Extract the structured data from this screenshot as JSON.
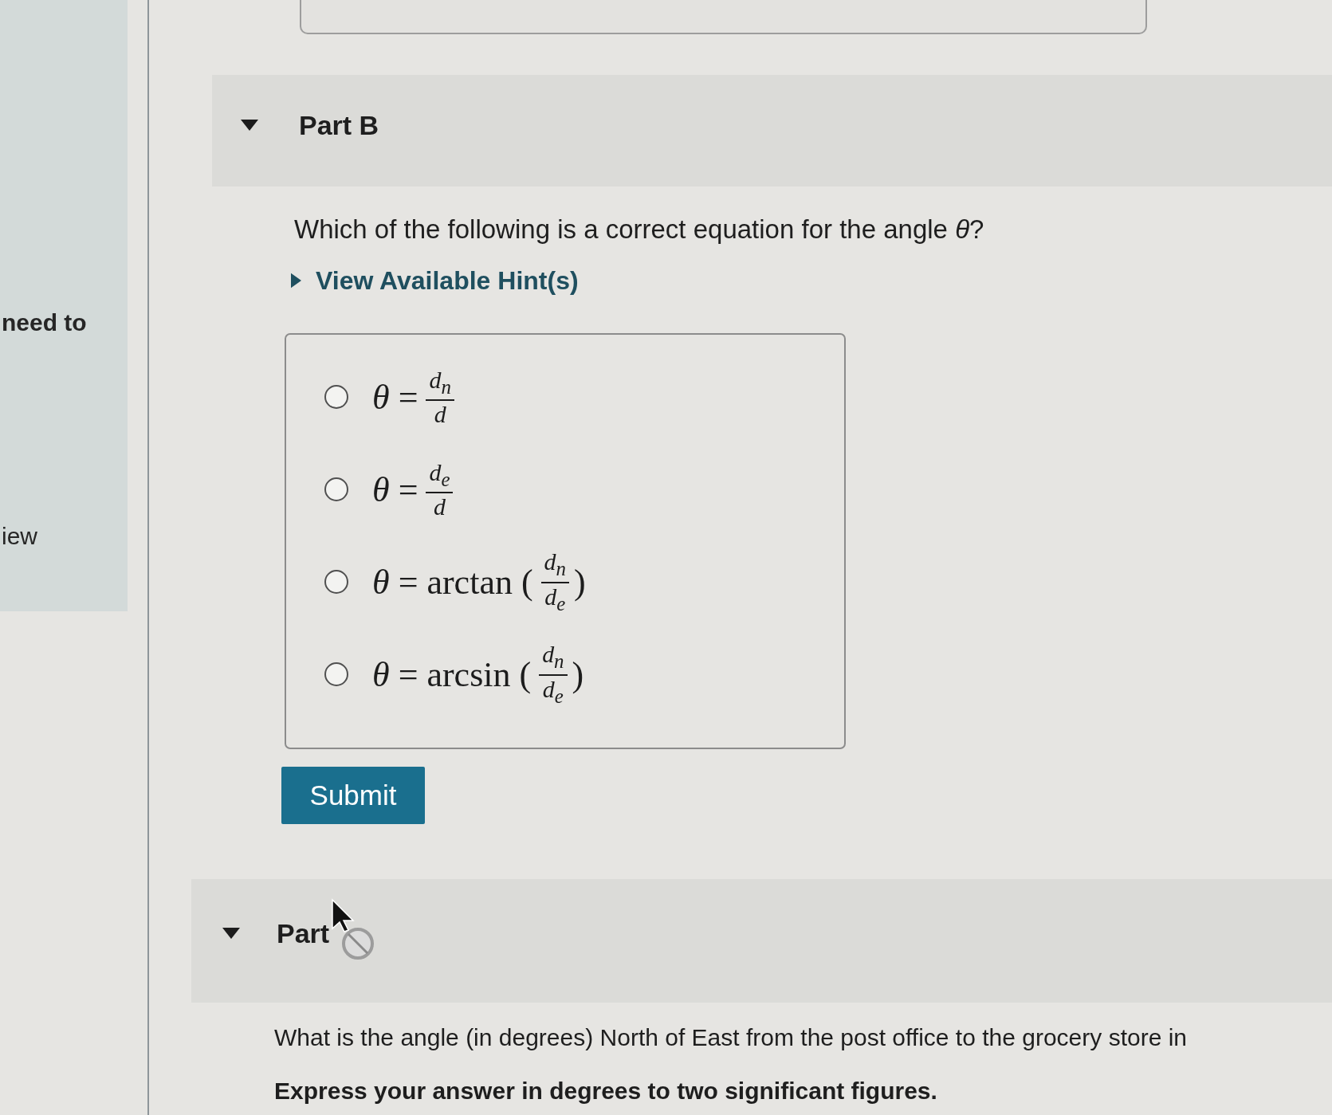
{
  "sidebar": {
    "texts": [
      "need to",
      "iew"
    ]
  },
  "parts": [
    {
      "title": "Part B",
      "expanded": true,
      "question": "Which of the following is a correct equation for the angle *θ*?",
      "hint_link": {
        "label": "View Available Hint(s)",
        "expanded": false
      },
      "options": [
        {
          "selected": false,
          "left": "*θ* =",
          "numerator": "d$_{n}$",
          "denominator": "d"
        },
        {
          "selected": false,
          "left": "*θ* =",
          "numerator": "d$_{e}$",
          "denominator": "d"
        },
        {
          "selected": false,
          "left": "*θ* = arctan (",
          "numerator": "d$_{n}$",
          "denominator": "d$_{e}$",
          "right": ")"
        },
        {
          "selected": false,
          "left": "*θ* = arcsin (",
          "numerator": "d$_{n}$",
          "denominator": "d$_{e}$",
          "right": ")"
        }
      ],
      "submit_button": "Submit"
    },
    {
      "title": "Part",
      "expanded": true,
      "question": "What is the angle (in degrees) North of East from the post office to the grocery store in",
      "instruction": "Express your answer in degrees to two significant figures."
    }
  ]
}
